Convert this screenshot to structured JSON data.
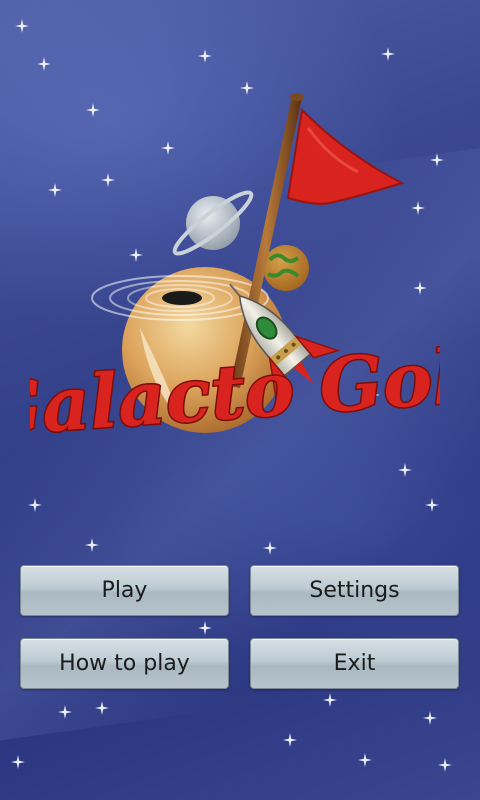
{
  "app": {
    "title": "Galacto Golf"
  },
  "menu": {
    "play_label": "Play",
    "settings_label": "Settings",
    "how_to_play_label": "How to play",
    "exit_label": "Exit"
  },
  "colors": {
    "background": "#34418a",
    "flag": "#d8231f",
    "logo_text": "#d8231f",
    "button_face": "#bccbd3"
  },
  "icons": {
    "logo": "galacto-golf-logo",
    "decorations": [
      "ringed-planet-icon",
      "black-hole-icon",
      "rocket-icon",
      "golf-flag-icon",
      "green-planet-icon",
      "orange-planet-icon"
    ]
  }
}
